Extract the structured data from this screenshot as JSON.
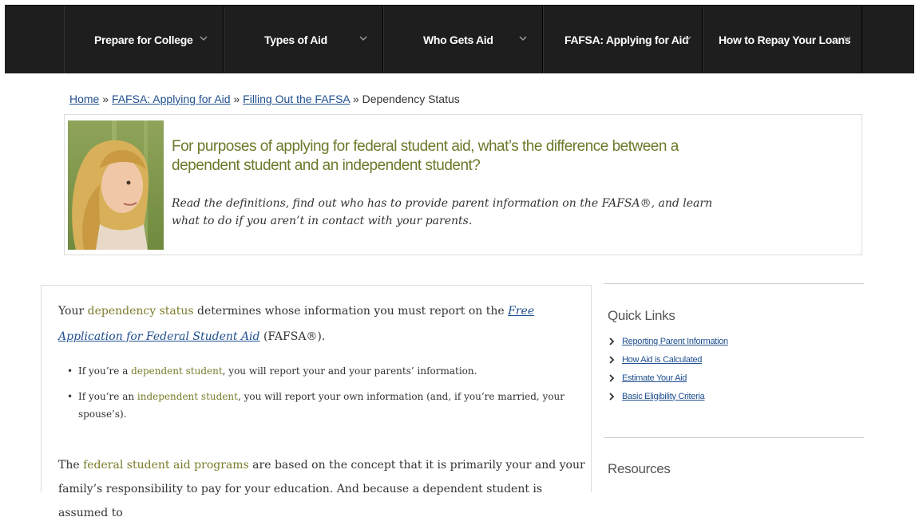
{
  "nav": {
    "items": [
      {
        "label": "Prepare for College"
      },
      {
        "label": "Types of Aid"
      },
      {
        "label": "Who Gets Aid"
      },
      {
        "label": "FAFSA: Applying for Aid"
      },
      {
        "label": "How to Repay Your Loans"
      }
    ]
  },
  "breadcrumb": {
    "home": "Home",
    "sep1": " » ",
    "fafsa": "FAFSA: Applying for Aid",
    "sep2": " » ",
    "filling": "Filling Out the FAFSA",
    "sep3": " » ",
    "current": "Dependency Status"
  },
  "hero": {
    "title": "For purposes of applying for federal student aid, what’s the difference between a dependent student and an independent student?",
    "subtitle": "Read the definitions, find out who has to provide parent information on the FAFSA®, and learn what to do if you aren’t in contact with your parents."
  },
  "main": {
    "p1_a": "Your ",
    "p1_hl": "dependency status",
    "p1_b": " determines whose information you must report on the ",
    "p1_link": "Free Application for Federal Student Aid",
    "p1_c": " (FAFSA®).",
    "bullet1_a": "If you’re a ",
    "bullet1_hl": "dependent student",
    "bullet1_b": ", you will report your and your parents’ information.",
    "bullet2_a": "If you’re an ",
    "bullet2_hl": "independent student",
    "bullet2_b": ", you will report your own information (and, if you’re married, your spouse’s).",
    "p2_a": "The ",
    "p2_hl": "federal student aid programs",
    "p2_b": " are based on the concept that it is primarily your and your family’s responsibility to pay for your education. And because a dependent student is assumed to"
  },
  "sidebar": {
    "quick_links_title": "Quick Links",
    "links": [
      {
        "label": "Reporting Parent Information"
      },
      {
        "label": "How Aid is Calculated"
      },
      {
        "label": "Estimate Your Aid"
      },
      {
        "label": "Basic Eligibility Criteria"
      }
    ],
    "resources_title": "Resources"
  },
  "colors": {
    "nav_bg": "#1e1e1e",
    "accent_olive": "#6b7a2a",
    "link_blue": "#1f4f8f"
  },
  "icons": {
    "nav_chevron": "chevron-down-icon",
    "quick_link_arrow": "chevron-right-icon"
  }
}
